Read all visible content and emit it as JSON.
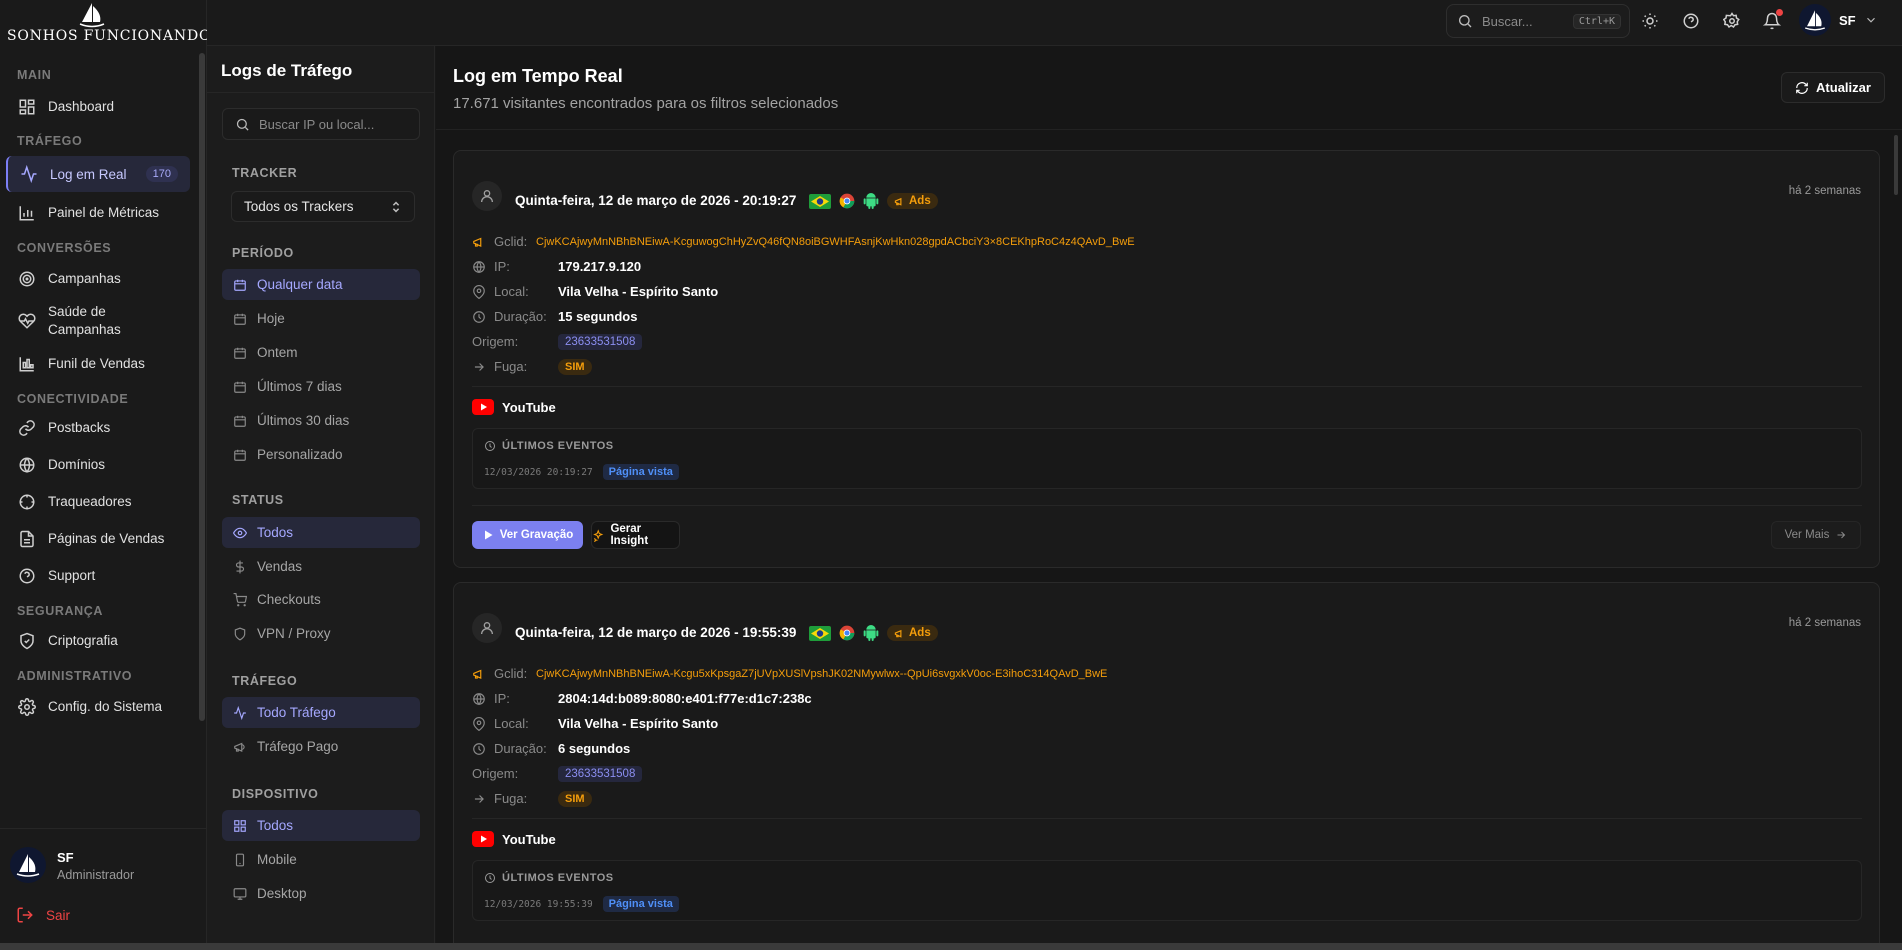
{
  "brand": {
    "name": "Sonhos Funcionando"
  },
  "sidebar": {
    "sections": {
      "main": "MAIN",
      "trafego": "TRÁFEGO",
      "conversoes": "CONVERSÕES",
      "conectividade": "CONECTIVIDADE",
      "seguranca": "SEGURANÇA",
      "administrativo": "ADMINISTRATIVO"
    },
    "items": {
      "dashboard": "Dashboard",
      "log_real": "Log em Real",
      "log_real_badge": "170",
      "painel_metricas": "Painel de Métricas",
      "campanhas": "Campanhas",
      "saude_campanhas": "Saúde de Campanhas",
      "funil_vendas": "Funil de Vendas",
      "postbacks": "Postbacks",
      "dominios": "Domínios",
      "traqueadores": "Traqueadores",
      "paginas_vendas": "Páginas de Vendas",
      "support": "Support",
      "criptografia": "Criptografia",
      "config_sistema": "Config. do Sistema"
    },
    "user": {
      "initials": "SF",
      "role": "Administrador",
      "logout": "Sair"
    }
  },
  "topbar": {
    "search_placeholder": "Buscar...",
    "shortcut": "Ctrl+K",
    "user_initials": "SF"
  },
  "filters": {
    "title": "Logs de Tráfego",
    "search_placeholder": "Buscar IP ou local...",
    "tracker_label": "TRACKER",
    "tracker_value": "Todos os Trackers",
    "periodo_label": "PERÍODO",
    "periodo": [
      "Qualquer data",
      "Hoje",
      "Ontem",
      "Últimos 7 dias",
      "Últimos 30 dias",
      "Personalizado"
    ],
    "status_label": "STATUS",
    "status": [
      "Todos",
      "Vendas",
      "Checkouts",
      "VPN / Proxy"
    ],
    "trafego_label": "TRÁFEGO",
    "trafego": [
      "Todo Tráfego",
      "Tráfego Pago"
    ],
    "dispositivo_label": "DISPOSITIVO",
    "dispositivo": [
      "Todos",
      "Mobile",
      "Desktop"
    ]
  },
  "main": {
    "title": "Log em Tempo Real",
    "subtitle": "17.671 visitantes encontrados para os filtros selecionados",
    "refresh": "Atualizar",
    "labels": {
      "gclid": "Gclid:",
      "ip": "IP:",
      "local": "Local:",
      "duracao": "Duração:",
      "origem": "Origem:",
      "fuga": "Fuga:",
      "ads": "Ads",
      "events_header": "ÚLTIMOS EVENTOS",
      "ver_gravacao": "Ver Gravação",
      "gerar_insight": "Gerar Insight",
      "ver_mais": "Ver Mais"
    },
    "visits": [
      {
        "title": "Quinta-feira, 12 de março de 2026 - 20:19:27",
        "ago": "há 2 semanas",
        "gclid": "CjwKCAjwyMnNBhBNEiwA-KcguwogChHyZvQ46fQN8oiBGWHFAsnjKwHkn028gpdACbciY3×8CEKhpRoC4z4QAvD_BwE",
        "ip": "179.217.9.120",
        "local": "Vila Velha - Espírito Santo",
        "duracao": "15 segundos",
        "origem": "23633531508",
        "fuga": "SIM",
        "source": "YouTube",
        "event_time": "12/03/2026 20:19:27",
        "event_name": "Página vista"
      },
      {
        "title": "Quinta-feira, 12 de março de 2026 - 19:55:39",
        "ago": "há 2 semanas",
        "gclid": "CjwKCAjwyMnNBhBNEiwA-Kcgu5xKpsgaZ7jUVpXUSlVpshJK02NMywlwx--QpUi6svgxkV0oc-E3ihoC314QAvD_BwE",
        "ip": "2804:14d:b089:8080:e401:f77e:d1c7:238c",
        "local": "Vila Velha - Espírito Santo",
        "duracao": "6 segundos",
        "origem": "23633531508",
        "fuga": "SIM",
        "source": "YouTube",
        "event_time": "12/03/2026 19:55:39",
        "event_name": "Página vista"
      }
    ]
  },
  "colors": {
    "accent": "#7c80f0",
    "warning": "#f59e0b",
    "danger": "#ef4444",
    "background": "#161616"
  },
  "icons": [
    "dashboard-icon",
    "activity-icon",
    "chart-icon",
    "target-icon",
    "heart-pulse-icon",
    "funnel-icon",
    "link-icon",
    "globe-icon",
    "crosshair-icon",
    "file-icon",
    "help-icon",
    "shield-icon",
    "gear-icon",
    "logout-icon",
    "search-icon",
    "sun-icon",
    "bell-icon",
    "chevron-down-icon",
    "calendar-icon",
    "eye-icon",
    "dollar-icon",
    "cart-icon",
    "megaphone-icon",
    "grid-icon",
    "phone-icon",
    "monitor-icon",
    "user-icon",
    "map-pin-icon",
    "clock-icon",
    "arrow-right-icon",
    "youtube-icon",
    "play-icon",
    "sparkle-icon",
    "refresh-icon"
  ]
}
